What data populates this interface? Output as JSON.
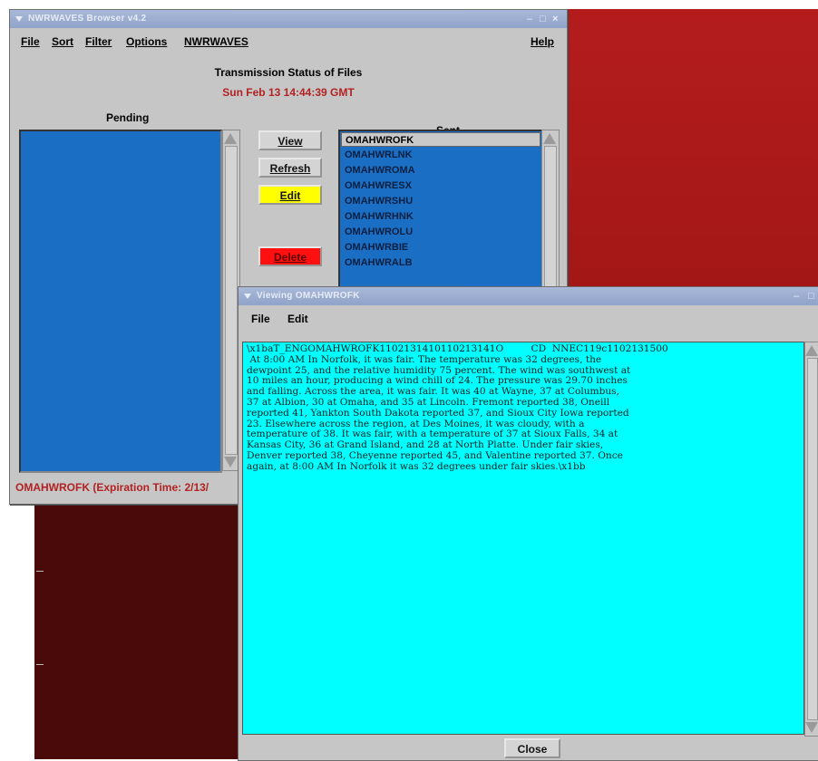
{
  "main_window": {
    "title": "NWRWAVES Browser v4.2",
    "menu": [
      "File",
      "Sort",
      "Filter",
      "Options",
      "NWRWAVES",
      "Help"
    ],
    "heading": "Transmission Status of Files",
    "timestamp": "Sun Feb 13  14:44:39 GMT",
    "pending_label": "Pending",
    "sent_label": "Sent",
    "buttons": {
      "view": "View",
      "refresh": "Refresh",
      "edit": "Edit",
      "delete": "Delete"
    },
    "sent_items": [
      "OMAHWROFK",
      "OMAHWRLNK",
      "OMAHWROMA",
      "OMAHWRESX",
      "OMAHWRSHU",
      "OMAHWRHNK",
      "OMAHWROLU",
      "OMAHWRBIE",
      "OMAHWRALB"
    ],
    "selected_item": "OMAHWROFK",
    "status": "OMAHWROFK (Expiration Time: 2/13/"
  },
  "viewer_window": {
    "title": "Viewing OMAHWROFK",
    "menu": [
      "File",
      "Edit"
    ],
    "content": "\\x1baT_ENGOMAHWROFK1102131410110213141O         CD  NNEC119c1102131500\n At 8:00 AM In Norfolk, it was fair. The temperature was 32 degrees, the\ndewpoint 25, and the relative humidity 75 percent. The wind was southwest at\n10 miles an hour, producing a wind chill of 24. The pressure was 29.70 inches\nand falling. Across the area, it was fair. It was 40 at Wayne, 37 at Columbus,\n37 at Albion, 30 at Omaha, and 35 at Lincoln. Fremont reported 38, Oneill\nreported 41, Yankton South Dakota reported 37, and Sioux City Iowa reported\n23. Elsewhere across the region, at Des Moines, it was cloudy, with a\ntemperature of 38. It was fair, with a temperature of 37 at Sioux Falls, 34 at\nKansas City, 36 at Grand Island, and 28 at North Platte. Under fair skies,\nDenver reported 38, Cheyenne reported 45, and Valentine reported 37. Once\nagain, at 8:00 AM In Norfolk it was 32 degrees under fair skies.\\x1bb",
    "close_label": "Close"
  },
  "colors": {
    "list_blue": "#1a6fc4",
    "edit_yellow": "#ffff00",
    "delete_red": "#ff1010",
    "text_cyan": "#00ffff",
    "timestamp_red": "#b22222",
    "desktop_red": "#a81818"
  }
}
